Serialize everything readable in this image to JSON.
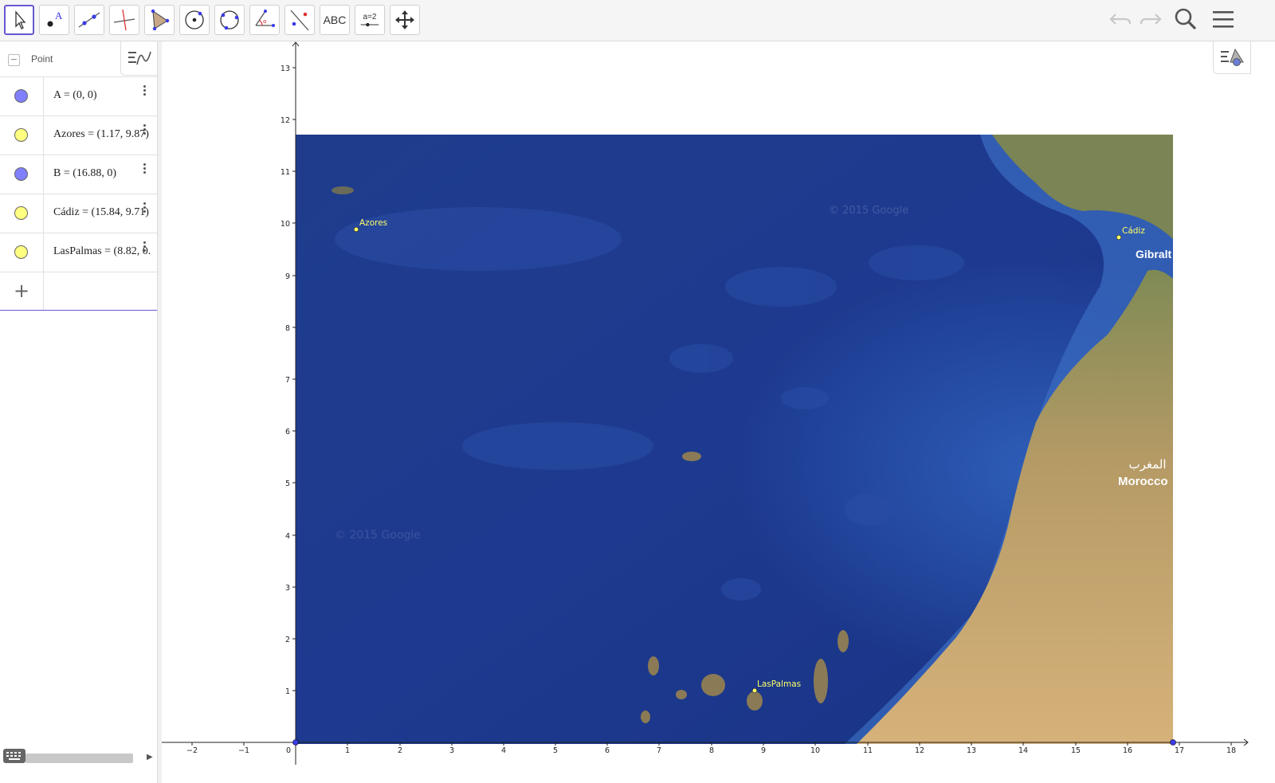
{
  "toolbar": {
    "tools": [
      {
        "name": "move-tool-button",
        "icon": "cursor-arrow-icon",
        "active": true
      },
      {
        "name": "point-tool-button",
        "icon": "point-a-icon"
      },
      {
        "name": "line-tool-button",
        "icon": "line-through-points-icon"
      },
      {
        "name": "perpendicular-tool-button",
        "icon": "perpendicular-line-icon"
      },
      {
        "name": "polygon-tool-button",
        "icon": "polygon-icon"
      },
      {
        "name": "circle-center-tool-button",
        "icon": "circle-center-point-icon"
      },
      {
        "name": "circle-three-points-tool-button",
        "icon": "circle-three-points-icon"
      },
      {
        "name": "angle-tool-button",
        "icon": "angle-icon"
      },
      {
        "name": "reflect-tool-button",
        "icon": "reflect-about-line-icon"
      },
      {
        "name": "text-tool-button",
        "label": "ABC"
      },
      {
        "name": "slider-tool-button",
        "label": "a=2"
      },
      {
        "name": "move-graphics-tool-button",
        "icon": "move-arrows-icon"
      }
    ],
    "right": [
      "undo-icon",
      "redo-icon",
      "search-icon",
      "menu-icon"
    ]
  },
  "algebra": {
    "header_title": "Point",
    "items": [
      {
        "expr": "A = (0, 0)",
        "color": "#8080ff"
      },
      {
        "expr": "Azores = (1.17, 9.87)",
        "color": "#ffff80"
      },
      {
        "expr": "B = (16.88, 0)",
        "color": "#8080ff"
      },
      {
        "expr": "Cádiz = (15.84, 9.71)",
        "color": "#ffff80"
      },
      {
        "expr": "LasPalmas = (8.82, 0.",
        "color": "#ffff80"
      }
    ],
    "input_symbol": "+"
  },
  "graphics": {
    "x_ticks": [
      "−2",
      "−1",
      "0",
      "1",
      "2",
      "3",
      "4",
      "5",
      "6",
      "7",
      "8",
      "9",
      "10",
      "11",
      "12",
      "13",
      "14",
      "15",
      "16",
      "17",
      "18"
    ],
    "y_ticks": [
      "1",
      "2",
      "3",
      "4",
      "5",
      "6",
      "7",
      "8",
      "9",
      "10",
      "11",
      "12",
      "13"
    ],
    "map_labels": {
      "azores": "Azores",
      "cadiz": "Cádiz",
      "laspalmas": "LasPalmas",
      "gibraltar": "Gibralt",
      "morocco_ar": "المغرب",
      "morocco": "Morocco",
      "watermark": "© 2015 Google"
    },
    "point_label_color": "#ffff66"
  }
}
